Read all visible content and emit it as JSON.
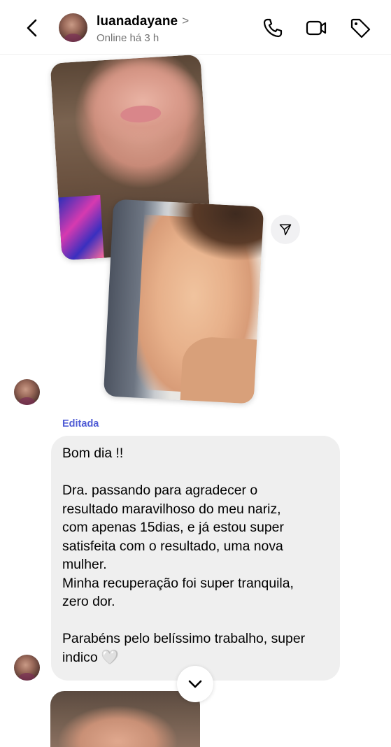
{
  "header": {
    "username": "luanadayane",
    "chevron": ">",
    "status": "Online há 3 h"
  },
  "icons": {
    "back": "back-arrow-icon",
    "phone": "phone-icon",
    "video": "video-camera-icon",
    "tag": "tag-icon",
    "share": "paper-plane-icon",
    "scroll_down": "chevron-down-icon"
  },
  "message": {
    "edited_label": "Editada",
    "text": "Bom dia !!\n\nDra. passando para agradecer o\nresultado maravilhoso do meu nariz,\ncom apenas 15dias, e já estou super\nsatisfeita com o resultado, uma nova\nmulher.\nMinha recuperação foi super tranquila,\nzero dor.\n\nParabéns pelo belíssimo trabalho, super\nindico ",
    "emoji": "🤍"
  },
  "colors": {
    "edited": "#4f5bd5",
    "bubble": "#efefef",
    "secondary_text": "#737373"
  }
}
